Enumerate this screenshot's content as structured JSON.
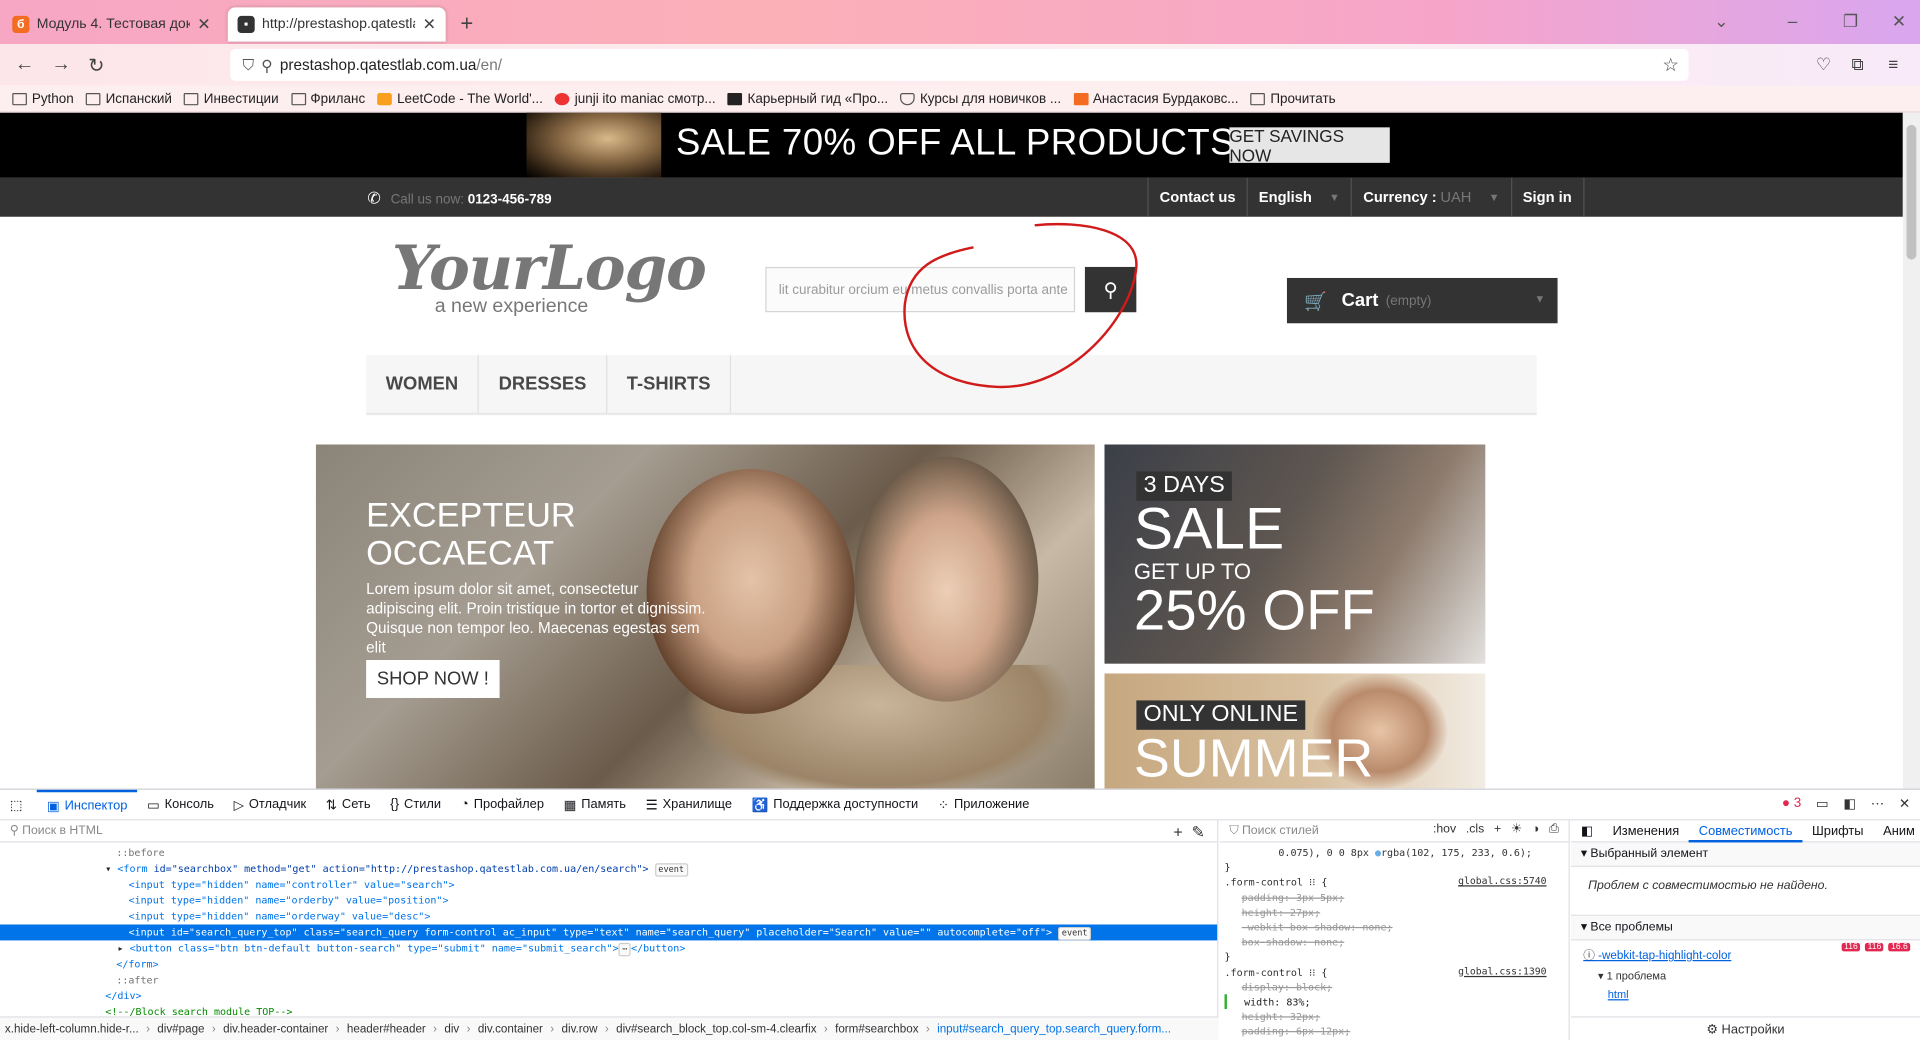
{
  "browser": {
    "tabs": [
      {
        "label": "Модуль 4. Тестовая документа...",
        "favicon_color": "#f36c21"
      },
      {
        "label": "http://prestashop.qatestlab.com...",
        "favicon_color": "#333333"
      }
    ],
    "url_host": "prestashop.qatestlab.com.ua",
    "url_path": "/en/",
    "bookmarks": [
      "Python",
      "Испанский",
      "Инвестиции",
      "Фриланс",
      "LeetCode - The World'...",
      "junji ito maniac смотр...",
      "Карьерный гид «Про...",
      "Курсы для новичков ...",
      "Анастасия Бурдаковс...",
      "Прочитать"
    ]
  },
  "site": {
    "banner_text": "SALE 70% OFF ALL PRODUCTS",
    "banner_button": "GET SAVINGS NOW",
    "call_label": "Call us now:",
    "phone": "0123-456-789",
    "nav": {
      "contact": "Contact us",
      "language": "English",
      "currency_label": "Currency :",
      "currency_value": "UAH",
      "signin": "Sign in"
    },
    "logo_text": "YourLogo",
    "logo_sub": "a new experience",
    "search_value": "lit curabitur orcium eu metus convallis porta ante",
    "cart_label": "Cart",
    "cart_state": "(empty)",
    "menu": [
      "WOMEN",
      "DRESSES",
      "T-SHIRTS"
    ],
    "slide": {
      "title": "EXCEPTEUR OCCAECAT",
      "text": "Lorem ipsum dolor sit amet, consectetur adipiscing elit. Proin tristique in tortor et dignissim. Quisque non tempor leo. Maecenas egestas sem elit",
      "button": "SHOP NOW !"
    },
    "promo1": {
      "tag": "3 DAYS",
      "big": "SALE",
      "mid": "GET UP TO",
      "pct": "25% OFF"
    },
    "promo2": {
      "tag": "ONLY ONLINE",
      "big": "SUMMER"
    }
  },
  "devtools": {
    "tabs": [
      "Инспектор",
      "Консоль",
      "Отладчик",
      "Сеть",
      "Стили",
      "Профайлер",
      "Память",
      "Хранилище",
      "Поддержка доступности",
      "Приложение"
    ],
    "error_count": "3",
    "html_search_placeholder": "Поиск в HTML",
    "styles_search_placeholder": "Поиск стилей",
    "styles_tools": [
      ":hov",
      ".cls"
    ],
    "html_lines": {
      "l1": "::before",
      "l2_tag": "<form",
      "l2_attrs": " id=\"searchbox\" method=\"get\" action=\"http://prestashop.qatestlab.com.ua/en/search\">",
      "l3": "<input type=\"hidden\" name=\"controller\" value=\"search\">",
      "l4": "<input type=\"hidden\" name=\"orderby\" value=\"position\">",
      "l5": "<input type=\"hidden\" name=\"orderway\" value=\"desc\">",
      "l6": "<input id=\"search_query_top\" class=\"search_query form-control ac_input\" type=\"text\" name=\"search_query\" placeholder=\"Search\" value=\"\" autocomplete=\"off\">",
      "l7": "<button class=\"btn btn-default button-search\" type=\"submit\" name=\"submit_search\">",
      "l7_end": "</button>",
      "l8": "</form>",
      "l9": "::after",
      "l10": "</div>",
      "l11": "<!--/Block search module TOP-->",
      "event": "event"
    },
    "breadcrumbs": [
      "x.hide-left-column.hide-r...",
      "div#page",
      "div.header-container",
      "header#header",
      "div",
      "div.container",
      "div.row",
      "div#search_block_top.col-sm-4.clearfix",
      "form#searchbox",
      "input#search_query_top.search_query.form..."
    ],
    "rules": {
      "top_line": "0.075), 0 0 8px",
      "top_color": "rgba(102, 175, 233, 0.6);",
      "r1_selector": ".form-control",
      "r1_src": "global.css:5740",
      "r1_props": [
        "padding: 3px 5px;",
        "height: 27px;",
        "-webkit-box-shadow: none;",
        "box-shadow: none;"
      ],
      "r2_selector": ".form-control",
      "r2_src": "global.css:1390",
      "r2_props": [
        "display: block;",
        "width: 83%;",
        "height: 32px;",
        "padding: 6px 12px;"
      ]
    },
    "compat": {
      "tabs": [
        "Изменения",
        "Совместимость",
        "Шрифты",
        "Аним"
      ],
      "selected_title": "Выбранный элемент",
      "no_issues": "Проблем с совместимостью не найдено.",
      "all_title": "Все проблемы",
      "issue_prop": "-webkit-tap-highlight-color",
      "issue_count": "1 проблема",
      "issue_child": "html",
      "badges": [
        "116",
        "116",
        "16.6"
      ],
      "settings": "Настройки"
    }
  }
}
